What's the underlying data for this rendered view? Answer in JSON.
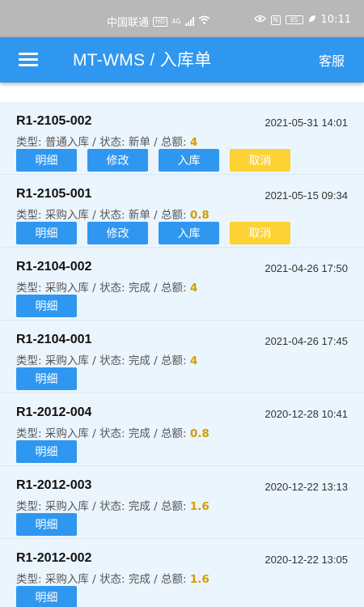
{
  "status_bar": {
    "carrier": "中国联通",
    "hd_badge": "HD",
    "network": "4G",
    "nfc_badge": "N",
    "battery": "95",
    "time": "10:11"
  },
  "app_bar": {
    "title": "MT-WMS / 入库单",
    "service_label": "客服",
    "menu_icon": "hamburger-menu-icon"
  },
  "labels": {
    "type_prefix": "类型: ",
    "status_prefix": " / 状态: ",
    "amount_prefix": " / 总额: "
  },
  "colors": {
    "primary": "#2f97f0",
    "warning": "#fdd234",
    "amount": "#d39e00"
  },
  "orders": [
    {
      "no": "R1-2105-002",
      "date": "2021-05-31 14:01",
      "type": "普通入库",
      "status": "新单",
      "amount": "4",
      "actions": [
        "明细",
        "修改",
        "入库",
        "取消"
      ]
    },
    {
      "no": "R1-2105-001",
      "date": "2021-05-15 09:34",
      "type": "采购入库",
      "status": "新单",
      "amount": "0.8",
      "actions": [
        "明细",
        "修改",
        "入库",
        "取消"
      ]
    },
    {
      "no": "R1-2104-002",
      "date": "2021-04-26 17:50",
      "type": "采购入库",
      "status": "完成",
      "amount": "4",
      "actions": [
        "明细"
      ]
    },
    {
      "no": "R1-2104-001",
      "date": "2021-04-26 17:45",
      "type": "采购入库",
      "status": "完成",
      "amount": "4",
      "actions": [
        "明细"
      ]
    },
    {
      "no": "R1-2012-004",
      "date": "2020-12-28 10:41",
      "type": "采购入库",
      "status": "完成",
      "amount": "0.8",
      "actions": [
        "明细"
      ]
    },
    {
      "no": "R1-2012-003",
      "date": "2020-12-22 13:13",
      "type": "采购入库",
      "status": "完成",
      "amount": "1.6",
      "actions": [
        "明细"
      ]
    },
    {
      "no": "R1-2012-002",
      "date": "2020-12-22 13:05",
      "type": "采购入库",
      "status": "完成",
      "amount": "1.6",
      "actions": [
        "明细"
      ]
    }
  ]
}
